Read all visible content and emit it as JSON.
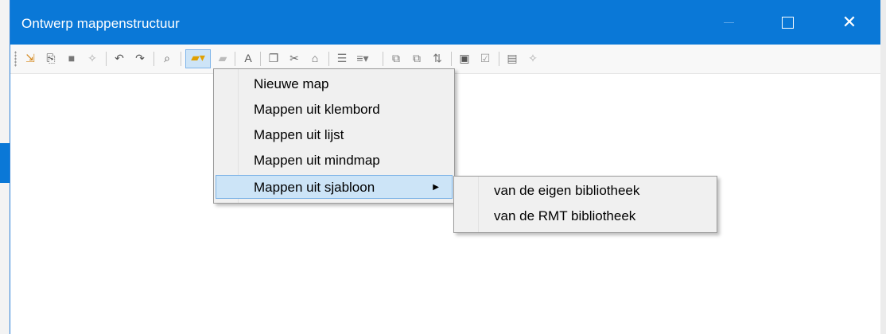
{
  "window": {
    "title": "Ontwerp mappenstructuur",
    "close_glyph": "✕"
  },
  "toolbar": {
    "icons": [
      "import-icon",
      "open-structure-icon",
      "save-icon",
      "wizard-icon",
      "undo-icon",
      "redo-icon",
      "find-icon",
      "new-folder-icon",
      "delete-folder-icon",
      "rename-icon",
      "copy-icon",
      "cut-icon",
      "paste-icon",
      "numbered-list-icon",
      "list-icon",
      "move-up-icon",
      "move-down-icon",
      "sort-icon",
      "lock-icon",
      "check-icon",
      "document-icon",
      "settings-icon"
    ]
  },
  "menu": {
    "items": [
      {
        "label": "Nieuwe map"
      },
      {
        "label": "Mappen uit klembord"
      },
      {
        "label": "Mappen uit lijst"
      },
      {
        "label": "Mappen uit mindmap"
      },
      {
        "label": "Mappen uit sjabloon",
        "submenu_arrow": "▶"
      }
    ]
  },
  "submenu": {
    "items": [
      {
        "label": "van de eigen bibliotheek"
      },
      {
        "label": "van de RMT bibliotheek"
      }
    ]
  },
  "colors": {
    "titlebar": "#0a78d7",
    "highlight": "#cce4f7"
  }
}
